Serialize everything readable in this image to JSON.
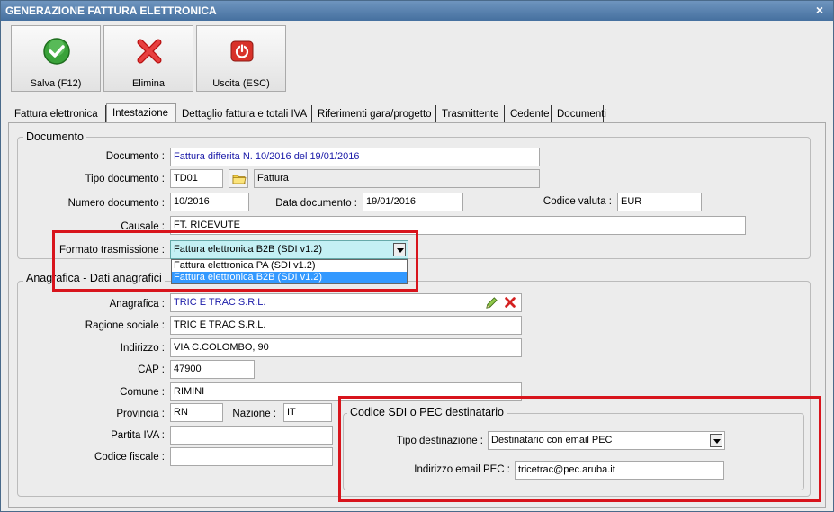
{
  "window": {
    "title": "GENERAZIONE FATTURA ELETTRONICA",
    "close_glyph": "×"
  },
  "toolbar": {
    "save_label": "Salva (F12)",
    "delete_label": "Elimina",
    "exit_label": "Uscita (ESC)"
  },
  "tabs": [
    {
      "label": "Fattura elettronica"
    },
    {
      "label": "Intestazione"
    },
    {
      "label": "Dettaglio fattura e totali IVA"
    },
    {
      "label": "Riferimenti gara/progetto"
    },
    {
      "label": "Trasmittente"
    },
    {
      "label": "Cedente"
    },
    {
      "label": "Documenti"
    }
  ],
  "documento": {
    "title": "Documento",
    "documento_label": "Documento :",
    "documento_value": "Fattura differita N. 10/2016 del 19/01/2016",
    "tipo_label": "Tipo documento :",
    "tipo_code": "TD01",
    "tipo_desc": "Fattura",
    "numero_label": "Numero documento :",
    "numero_value": "10/2016",
    "data_label": "Data documento :",
    "data_value": "19/01/2016",
    "valuta_label": "Codice valuta :",
    "valuta_value": "EUR",
    "causale_label": "Causale :",
    "causale_value": "FT. RICEVUTE",
    "formato_label": "Formato trasmissione :",
    "formato_value": "Fattura elettronica B2B (SDI v1.2)",
    "formato_options": [
      "Fattura elettronica PA (SDI v1.2)",
      "Fattura elettronica B2B (SDI v1.2)"
    ]
  },
  "anagrafica": {
    "title": "Anagrafica - Dati anagrafici",
    "anagrafica_label": "Anagrafica :",
    "anagrafica_value": "TRIC E TRAC S.R.L.",
    "ragione_label": "Ragione sociale :",
    "ragione_value": "TRIC E TRAC S.R.L.",
    "indirizzo_label": "Indirizzo :",
    "indirizzo_value": "VIA C.COLOMBO, 90",
    "cap_label": "CAP :",
    "cap_value": "47900",
    "comune_label": "Comune :",
    "comune_value": "RIMINI",
    "provincia_label": "Provincia :",
    "provincia_value": "RN",
    "nazione_label": "Nazione :",
    "nazione_value": "IT",
    "piva_label": "Partita IVA :",
    "piva_value": "",
    "cf_label": "Codice fiscale :",
    "cf_value": ""
  },
  "sdi": {
    "title": "Codice SDI o PEC destinatario",
    "tipo_label": "Tipo destinazione :",
    "tipo_value": "Destinatario con email PEC",
    "pec_label": "Indirizzo email PEC :",
    "pec_value": "tricetrac@pec.aruba.it"
  },
  "icons": {
    "save": "check-circle-icon",
    "delete": "red-x-icon",
    "exit": "power-icon",
    "folder": "folder-icon",
    "edit": "pencil-icon",
    "remove": "small-red-x-icon"
  },
  "colors": {
    "title_bar": "#45709f",
    "highlight_box": "#d8141c",
    "combo_highlight": "#c4f0f4",
    "selected_option": "#3399ff",
    "link_text": "#1a1aa8"
  }
}
